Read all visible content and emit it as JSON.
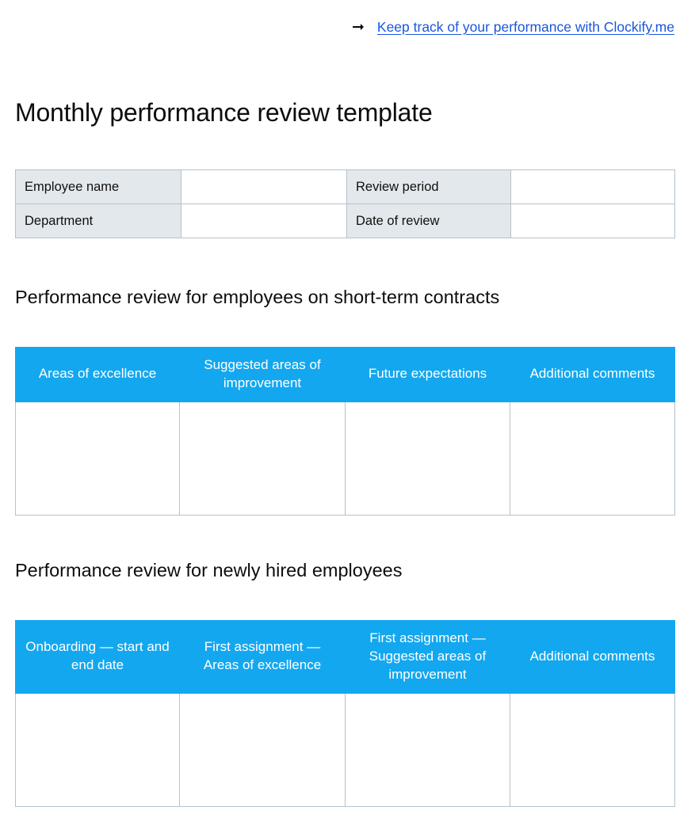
{
  "promo": {
    "arrow_icon": "arrow-right-icon",
    "link_text": "Keep track of your performance with Clockify.me",
    "link_color": "#1a56db"
  },
  "document": {
    "title": "Monthly performance review template"
  },
  "theme": {
    "header_blue": "#13a7ef",
    "label_grey": "#e3e8ec",
    "border_grey": "#b4c2cc"
  },
  "info_table": {
    "rows": [
      {
        "label_left": "Employee name",
        "value_left": "",
        "label_right": "Review period",
        "value_right": ""
      },
      {
        "label_left": "Department",
        "value_left": "",
        "label_right": "Date of review",
        "value_right": ""
      }
    ]
  },
  "sections": [
    {
      "heading": "Performance review for employees on short-term contracts",
      "table": {
        "headers": [
          "Areas of excellence",
          "Suggested areas of improvement",
          "Future expectations",
          "Additional comments"
        ],
        "rows": [
          [
            "",
            "",
            "",
            ""
          ]
        ]
      }
    },
    {
      "heading": "Performance review for newly hired employees",
      "table": {
        "headers": [
          "Onboarding — start and end date",
          "First assignment — Areas of excellence",
          "First assignment — Suggested areas of improvement",
          "Additional comments"
        ],
        "rows": [
          [
            "",
            "",
            "",
            ""
          ]
        ]
      }
    }
  ]
}
